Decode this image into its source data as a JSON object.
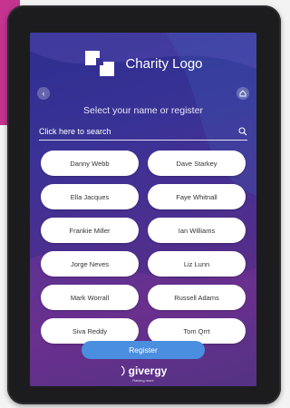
{
  "app": {
    "logo_text": "Charity Logo",
    "prompt": "Select your name or register",
    "search_placeholder": "Click here to search",
    "register_label": "Register",
    "brand_name": "givergy",
    "brand_tagline": "Raising more"
  },
  "people": [
    "Danny Webb",
    "Dave Starkey",
    "Ella Jacques",
    "Faye Whitnall",
    "Frankie Miller",
    "Ian Williams",
    "Jorge Neves",
    "Liz Lunn",
    "Mark Worrall",
    "Russell Adams",
    "Siva Reddy",
    "Tom Qrrt"
  ],
  "icons": {
    "back": "chevron-left-icon",
    "home": "home-icon",
    "search": "search-icon",
    "brand": "givergy-logo-icon"
  },
  "colors": {
    "accent": "#c4348f",
    "register": "#4a8ee0",
    "screen_bg": "#3a3296"
  }
}
